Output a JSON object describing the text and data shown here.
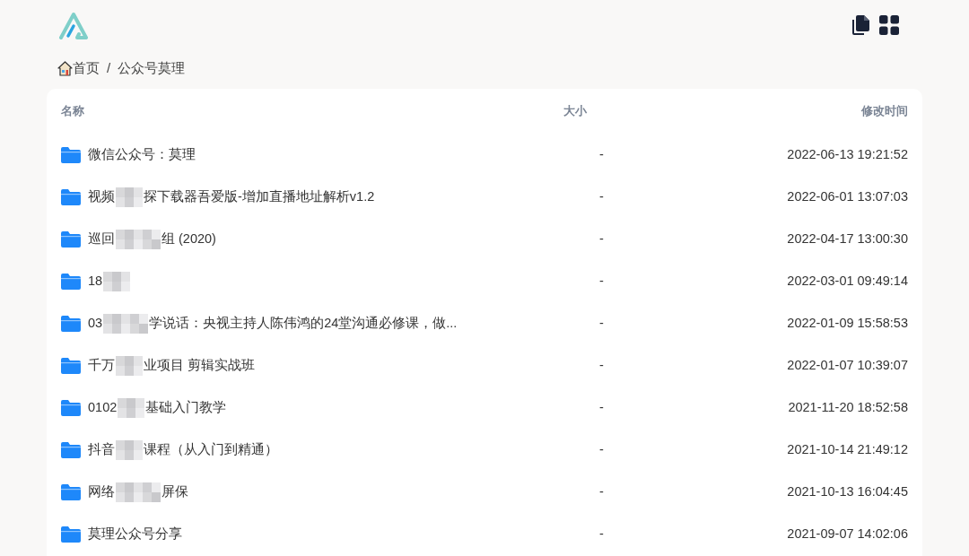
{
  "breadcrumb": [
    {
      "label": "首页",
      "kind": "home"
    },
    {
      "label": "公众号莫理",
      "kind": "folder"
    }
  ],
  "breadcrumb_separator": "/",
  "table": {
    "columns": [
      "名称",
      "大小",
      "修改时间"
    ],
    "rows": [
      {
        "name_parts": [
          "微信公众号：莫理"
        ],
        "size": "-",
        "modified": "2022-06-13 19:21:52"
      },
      {
        "name_parts": [
          "视频",
          "探下载器吾爱版-增加直播地址解析v1.2"
        ],
        "size": "-",
        "modified": "2022-06-01 13:07:03"
      },
      {
        "name_parts": [
          "巡回",
          "组 (2020)"
        ],
        "size": "-",
        "modified": "2022-04-17 13:00:30"
      },
      {
        "name_parts": [
          "18"
        ],
        "redacted_end": true,
        "size": "-",
        "modified": "2022-03-01 09:49:14"
      },
      {
        "name_parts": [
          "03",
          "学说话：央视主持人陈伟鸿的24堂沟通必修课，做..."
        ],
        "size": "-",
        "modified": "2022-01-09 15:58:53"
      },
      {
        "name_parts": [
          "千万",
          "业项目 剪辑实战班"
        ],
        "size": "-",
        "modified": "2022-01-07 10:39:07"
      },
      {
        "name_parts": [
          "0102",
          "基础入门教学"
        ],
        "size": "-",
        "modified": "2021-11-20 18:52:58"
      },
      {
        "name_parts": [
          "抖音",
          "课程（从入门到精通）"
        ],
        "size": "-",
        "modified": "2021-10-14 21:49:12"
      },
      {
        "name_parts": [
          "网络",
          "屏保"
        ],
        "size": "-",
        "modified": "2021-10-13 16:04:45"
      },
      {
        "name_parts": [
          "莫理公众号分享"
        ],
        "size": "-",
        "modified": "2021-09-07 14:02:06"
      }
    ]
  }
}
